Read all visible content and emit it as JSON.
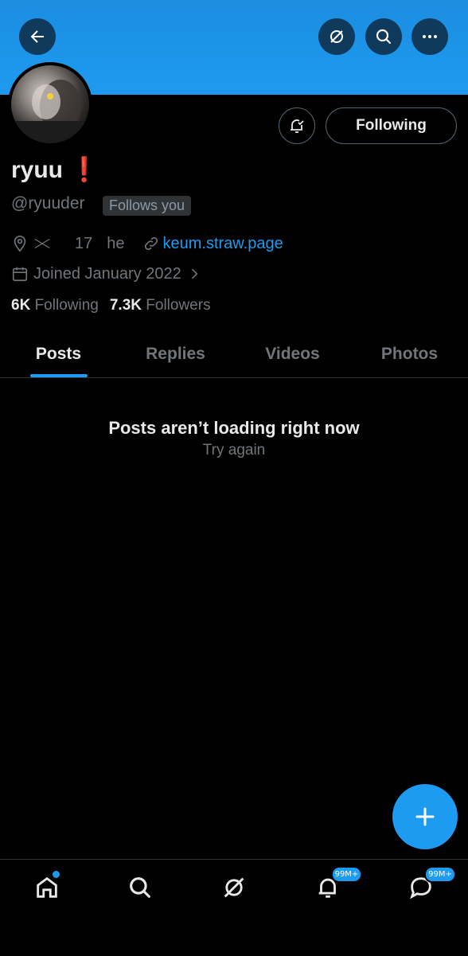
{
  "profile": {
    "name": "ryuu ❗️",
    "handle": "@ryuuder",
    "follows_you": "Follows you",
    "location_icon": "location-pin-icon",
    "bio_extra_1": "17",
    "bio_extra_2": "he",
    "website": "keum.straw.page",
    "joined": "Joined January 2022",
    "following_count": "6K",
    "following_label": "Following",
    "followers_count": "7.3K",
    "followers_label": "Followers"
  },
  "actions": {
    "following_button": "Following"
  },
  "tabs": [
    {
      "label": "Posts",
      "active": true
    },
    {
      "label": "Replies",
      "active": false
    },
    {
      "label": "Videos",
      "active": false
    },
    {
      "label": "Photos",
      "active": false
    }
  ],
  "feed": {
    "error_title": "Posts aren’t loading right now",
    "retry_label": "Try again"
  },
  "bottom_nav": {
    "notifications_badge": "99M+",
    "messages_badge": "99M+"
  },
  "colors": {
    "accent": "#1d9bf0",
    "background": "#000000",
    "muted_text": "#71767b"
  }
}
